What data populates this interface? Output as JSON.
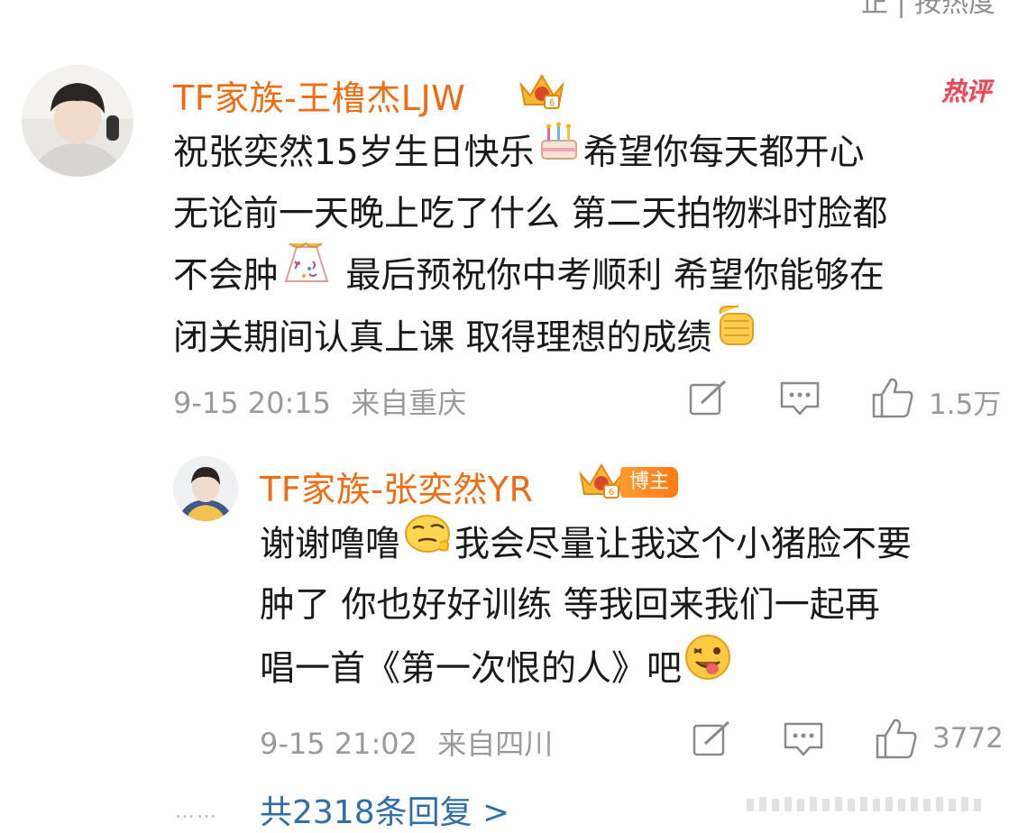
{
  "top_partial_text": "正 | 按热度",
  "comment": {
    "username": "TF家族-王橹杰LJW",
    "hot_badge": "热评",
    "text_lines": [
      [
        "祝张奕然15岁生日快乐",
        "🎂",
        "希望你每天都开心"
      ],
      [
        "无论前一天晚上吃了什么 第二天拍物料时脸都"
      ],
      [
        "不会肿",
        "🎊",
        " 最后预祝你中考顺利 希望你能够在"
      ],
      [
        "闭关期间认真上课 取得理想的成绩",
        "✊"
      ]
    ],
    "date": "9-15 20:15",
    "location": "来自重庆",
    "likes": "1.5万"
  },
  "reply": {
    "username": "TF家族-张奕然YR",
    "badge": "博主",
    "text_lines": [
      [
        "谢谢噜噜",
        "🤔",
        "我会尽量让我这个小猪脸不要"
      ],
      [
        "肿了  你也好好训练 等我回来我们一起再"
      ],
      [
        "唱一首《第一次恨的人》吧",
        "😜"
      ]
    ],
    "date": "9-15 21:02",
    "location": "来自四川",
    "likes": "3772"
  },
  "more": {
    "dots": "……",
    "label": "共2318条回复 >"
  },
  "colors": {
    "username": "#f06c12",
    "link": "#2f6ea8",
    "meta": "#9a9a9a",
    "hot": "#e8495a",
    "badge": "#ff8a1f"
  },
  "icons": [
    "comment-edit-icon",
    "repost-icon",
    "like-thumb-icon",
    "crown-badge-icon"
  ]
}
